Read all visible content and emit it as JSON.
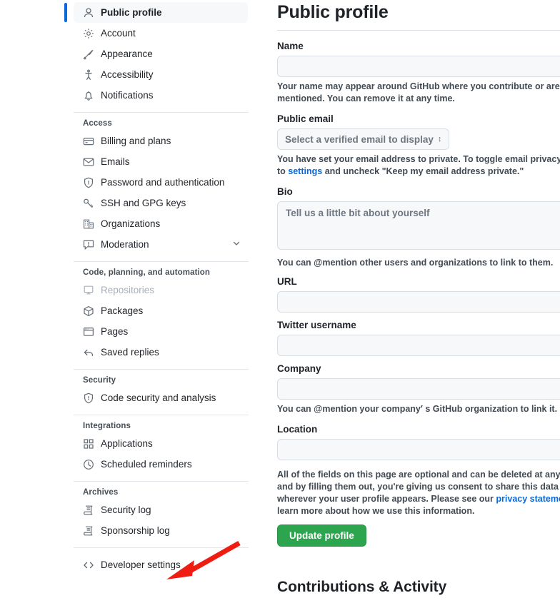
{
  "sidebar": {
    "groups": [
      {
        "title": null,
        "divider_before": false,
        "items": [
          {
            "label": "Public profile",
            "icon": "person-icon",
            "active": true,
            "muted": false,
            "chevron": false
          },
          {
            "label": "Account",
            "icon": "gear-icon",
            "active": false,
            "muted": false,
            "chevron": false
          },
          {
            "label": "Appearance",
            "icon": "paintbrush-icon",
            "active": false,
            "muted": false,
            "chevron": false
          },
          {
            "label": "Accessibility",
            "icon": "accessibility-icon",
            "active": false,
            "muted": false,
            "chevron": false
          },
          {
            "label": "Notifications",
            "icon": "bell-icon",
            "active": false,
            "muted": false,
            "chevron": false
          }
        ]
      },
      {
        "title": "Access",
        "divider_before": true,
        "items": [
          {
            "label": "Billing and plans",
            "icon": "credit-card-icon",
            "active": false,
            "muted": false,
            "chevron": false
          },
          {
            "label": "Emails",
            "icon": "mail-icon",
            "active": false,
            "muted": false,
            "chevron": false
          },
          {
            "label": "Password and authentication",
            "icon": "shield-lock-icon",
            "active": false,
            "muted": false,
            "chevron": false
          },
          {
            "label": "SSH and GPG keys",
            "icon": "key-icon",
            "active": false,
            "muted": false,
            "chevron": false
          },
          {
            "label": "Organizations",
            "icon": "organization-icon",
            "active": false,
            "muted": false,
            "chevron": false
          },
          {
            "label": "Moderation",
            "icon": "report-icon",
            "active": false,
            "muted": false,
            "chevron": true
          }
        ]
      },
      {
        "title": "Code, planning, and automation",
        "divider_before": true,
        "items": [
          {
            "label": "Repositories",
            "icon": "repo-icon",
            "active": false,
            "muted": true,
            "chevron": false
          },
          {
            "label": "Packages",
            "icon": "package-icon",
            "active": false,
            "muted": false,
            "chevron": false
          },
          {
            "label": "Pages",
            "icon": "browser-icon",
            "active": false,
            "muted": false,
            "chevron": false
          },
          {
            "label": "Saved replies",
            "icon": "reply-icon",
            "active": false,
            "muted": false,
            "chevron": false
          }
        ]
      },
      {
        "title": "Security",
        "divider_before": true,
        "items": [
          {
            "label": "Code security and analysis",
            "icon": "shield-check-icon",
            "active": false,
            "muted": false,
            "chevron": false
          }
        ]
      },
      {
        "title": "Integrations",
        "divider_before": true,
        "items": [
          {
            "label": "Applications",
            "icon": "apps-icon",
            "active": false,
            "muted": false,
            "chevron": false
          },
          {
            "label": "Scheduled reminders",
            "icon": "clock-icon",
            "active": false,
            "muted": false,
            "chevron": false
          }
        ]
      },
      {
        "title": "Archives",
        "divider_before": true,
        "items": [
          {
            "label": "Security log",
            "icon": "log-icon",
            "active": false,
            "muted": false,
            "chevron": false
          },
          {
            "label": "Sponsorship log",
            "icon": "log-icon",
            "active": false,
            "muted": false,
            "chevron": false
          }
        ]
      },
      {
        "title": null,
        "divider_before": true,
        "items": [
          {
            "label": "Developer settings",
            "icon": "code-icon",
            "active": false,
            "muted": false,
            "chevron": false
          }
        ]
      }
    ]
  },
  "main": {
    "page_title": "Public profile",
    "name": {
      "label": "Name",
      "value": "",
      "placeholder": "",
      "help": "Your name may appear around GitHub where you contribute or are mentioned. You can remove it at any time."
    },
    "public_email": {
      "label": "Public email",
      "selected": "Select a verified email to display",
      "help_before": "You have set your email address to private. To toggle email privacy, go to ",
      "help_link": "settings",
      "help_after": " and uncheck \"Keep my email address private.\""
    },
    "bio": {
      "label": "Bio",
      "value": "",
      "placeholder": "Tell us a little bit about yourself",
      "help": "You can @mention other users and organizations to link to them."
    },
    "url": {
      "label": "URL",
      "value": "",
      "placeholder": ""
    },
    "twitter": {
      "label": "Twitter username",
      "value": "",
      "placeholder": ""
    },
    "company": {
      "label": "Company",
      "value": "",
      "placeholder": "",
      "help": "You can @mention your company′ s GitHub organization to link it."
    },
    "location": {
      "label": "Location",
      "value": "",
      "placeholder": ""
    },
    "footer": {
      "before_link": "All of the fields on this page are optional and can be deleted at any time, and by filling them out, you're giving us consent to share this data wherever your user profile appears. Please see our ",
      "link": "privacy statement",
      "after_link": " to learn more about how we use this information."
    },
    "update_button": "Update profile",
    "contributions_heading": "Contributions & Activity"
  },
  "annotation": {
    "type": "red-arrow",
    "points_to": "Developer settings",
    "color": "#ee1c11"
  }
}
